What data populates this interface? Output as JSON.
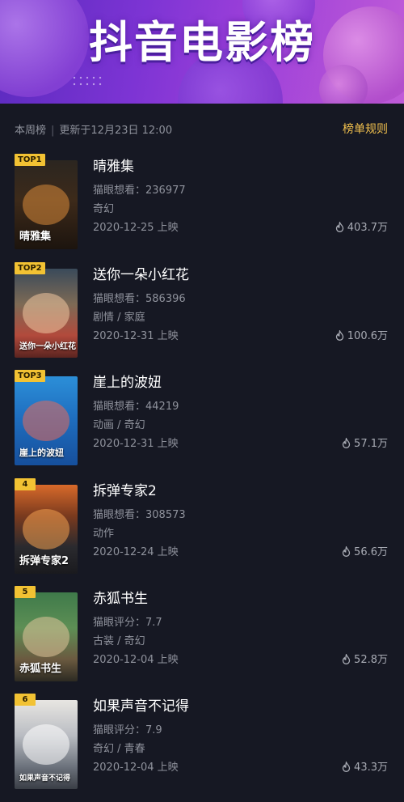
{
  "banner": {
    "title": "抖音电影榜"
  },
  "infobar": {
    "period": "本周榜",
    "updated": "更新于12月23日 12:00",
    "rules_link": "榜单规则"
  },
  "colors": {
    "accent": "#f2c233",
    "background": "#161823",
    "muted": "#8f929c"
  },
  "movies": [
    {
      "rank": "TOP1",
      "title": "晴雅集",
      "metric": "猫眼想看：236977",
      "genre": "奇幻",
      "release": "2020-12-25 上映",
      "heat": "403.7万",
      "poster_text": "晴雅集"
    },
    {
      "rank": "TOP2",
      "title": "送你一朵小红花",
      "metric": "猫眼想看：586396",
      "genre": "剧情 / 家庭",
      "release": "2020-12-31 上映",
      "heat": "100.6万",
      "poster_text": "送你一朵小红花"
    },
    {
      "rank": "TOP3",
      "title": "崖上的波妞",
      "metric": "猫眼想看：44219",
      "genre": "动画 / 奇幻",
      "release": "2020-12-31 上映",
      "heat": "57.1万",
      "poster_text": "崖上的波妞"
    },
    {
      "rank": "4",
      "title": "拆弹专家2",
      "metric": "猫眼想看：308573",
      "genre": "动作",
      "release": "2020-12-24 上映",
      "heat": "56.6万",
      "poster_text": "拆弹专家2"
    },
    {
      "rank": "5",
      "title": "赤狐书生",
      "metric": "猫眼评分：7.7",
      "genre": "古装 / 奇幻",
      "release": "2020-12-04 上映",
      "heat": "52.8万",
      "poster_text": "赤狐书生"
    },
    {
      "rank": "6",
      "title": "如果声音不记得",
      "metric": "猫眼评分：7.9",
      "genre": "奇幻 / 青春",
      "release": "2020-12-04 上映",
      "heat": "43.3万",
      "poster_text": "如果声音不记得"
    }
  ]
}
